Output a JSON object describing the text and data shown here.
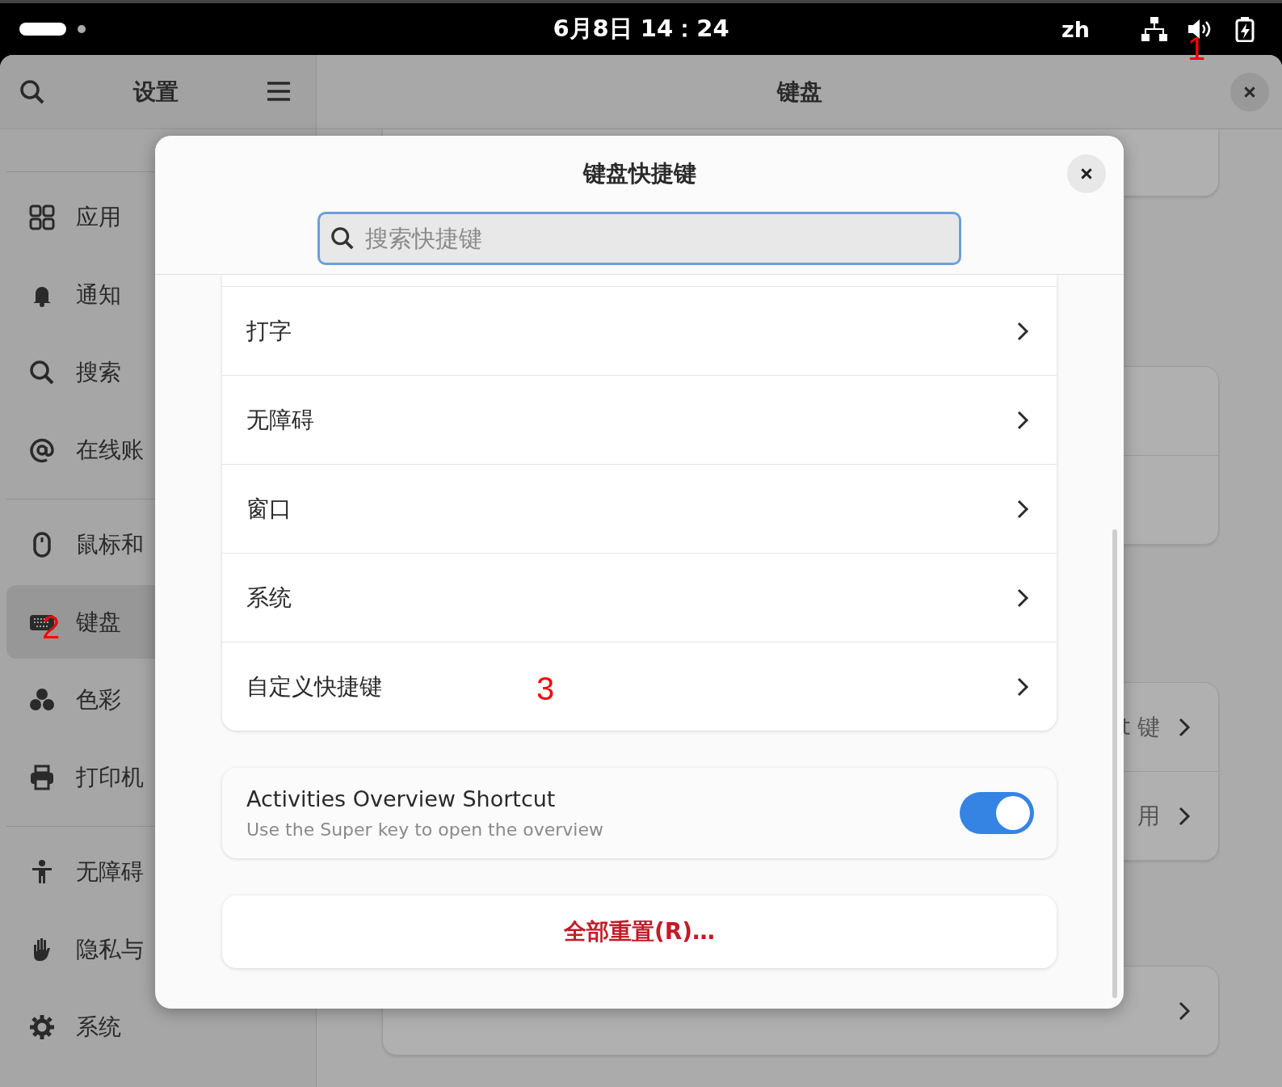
{
  "top_bar": {
    "clock": "6月8日 14：24",
    "input_method": "zh"
  },
  "settings": {
    "sidebar_title": "设置",
    "page_title": "键盘",
    "sidebar_groups": [
      [
        {
          "label": "应用",
          "kind": "apps",
          "selected": false
        },
        {
          "label": "通知",
          "kind": "bell",
          "selected": false
        },
        {
          "label": "搜索",
          "kind": "search",
          "selected": false
        },
        {
          "label": "在线账",
          "kind": "at",
          "selected": false
        }
      ],
      [
        {
          "label": "鼠标和",
          "kind": "mouse",
          "selected": false
        },
        {
          "label": "键盘",
          "kind": "keyboard",
          "selected": true
        },
        {
          "label": "色彩",
          "kind": "color",
          "selected": false
        },
        {
          "label": "打印机",
          "kind": "printer",
          "selected": false
        }
      ],
      [
        {
          "label": "无障碍",
          "kind": "person",
          "selected": false
        },
        {
          "label": "隐私与",
          "kind": "hand",
          "selected": false
        },
        {
          "label": "系统",
          "kind": "gear",
          "selected": false
        }
      ]
    ],
    "background_rows": [
      {
        "text": "t 键"
      },
      {
        "text": "用"
      }
    ]
  },
  "dialog": {
    "title": "键盘快捷键",
    "search": {
      "placeholder": "搜索快捷键"
    },
    "categories": [
      {
        "label": "打字"
      },
      {
        "label": "无障碍"
      },
      {
        "label": "窗口"
      },
      {
        "label": "系统"
      },
      {
        "label": "自定义快捷键"
      }
    ],
    "overview_shortcut": {
      "title": "Activities Overview Shortcut",
      "subtitle": "Use the Super key to open the overview",
      "on": true
    },
    "reset_button": "全部重置(R)…"
  },
  "annotations": [
    {
      "text": "1"
    },
    {
      "text": "2"
    },
    {
      "text": "3"
    }
  ]
}
